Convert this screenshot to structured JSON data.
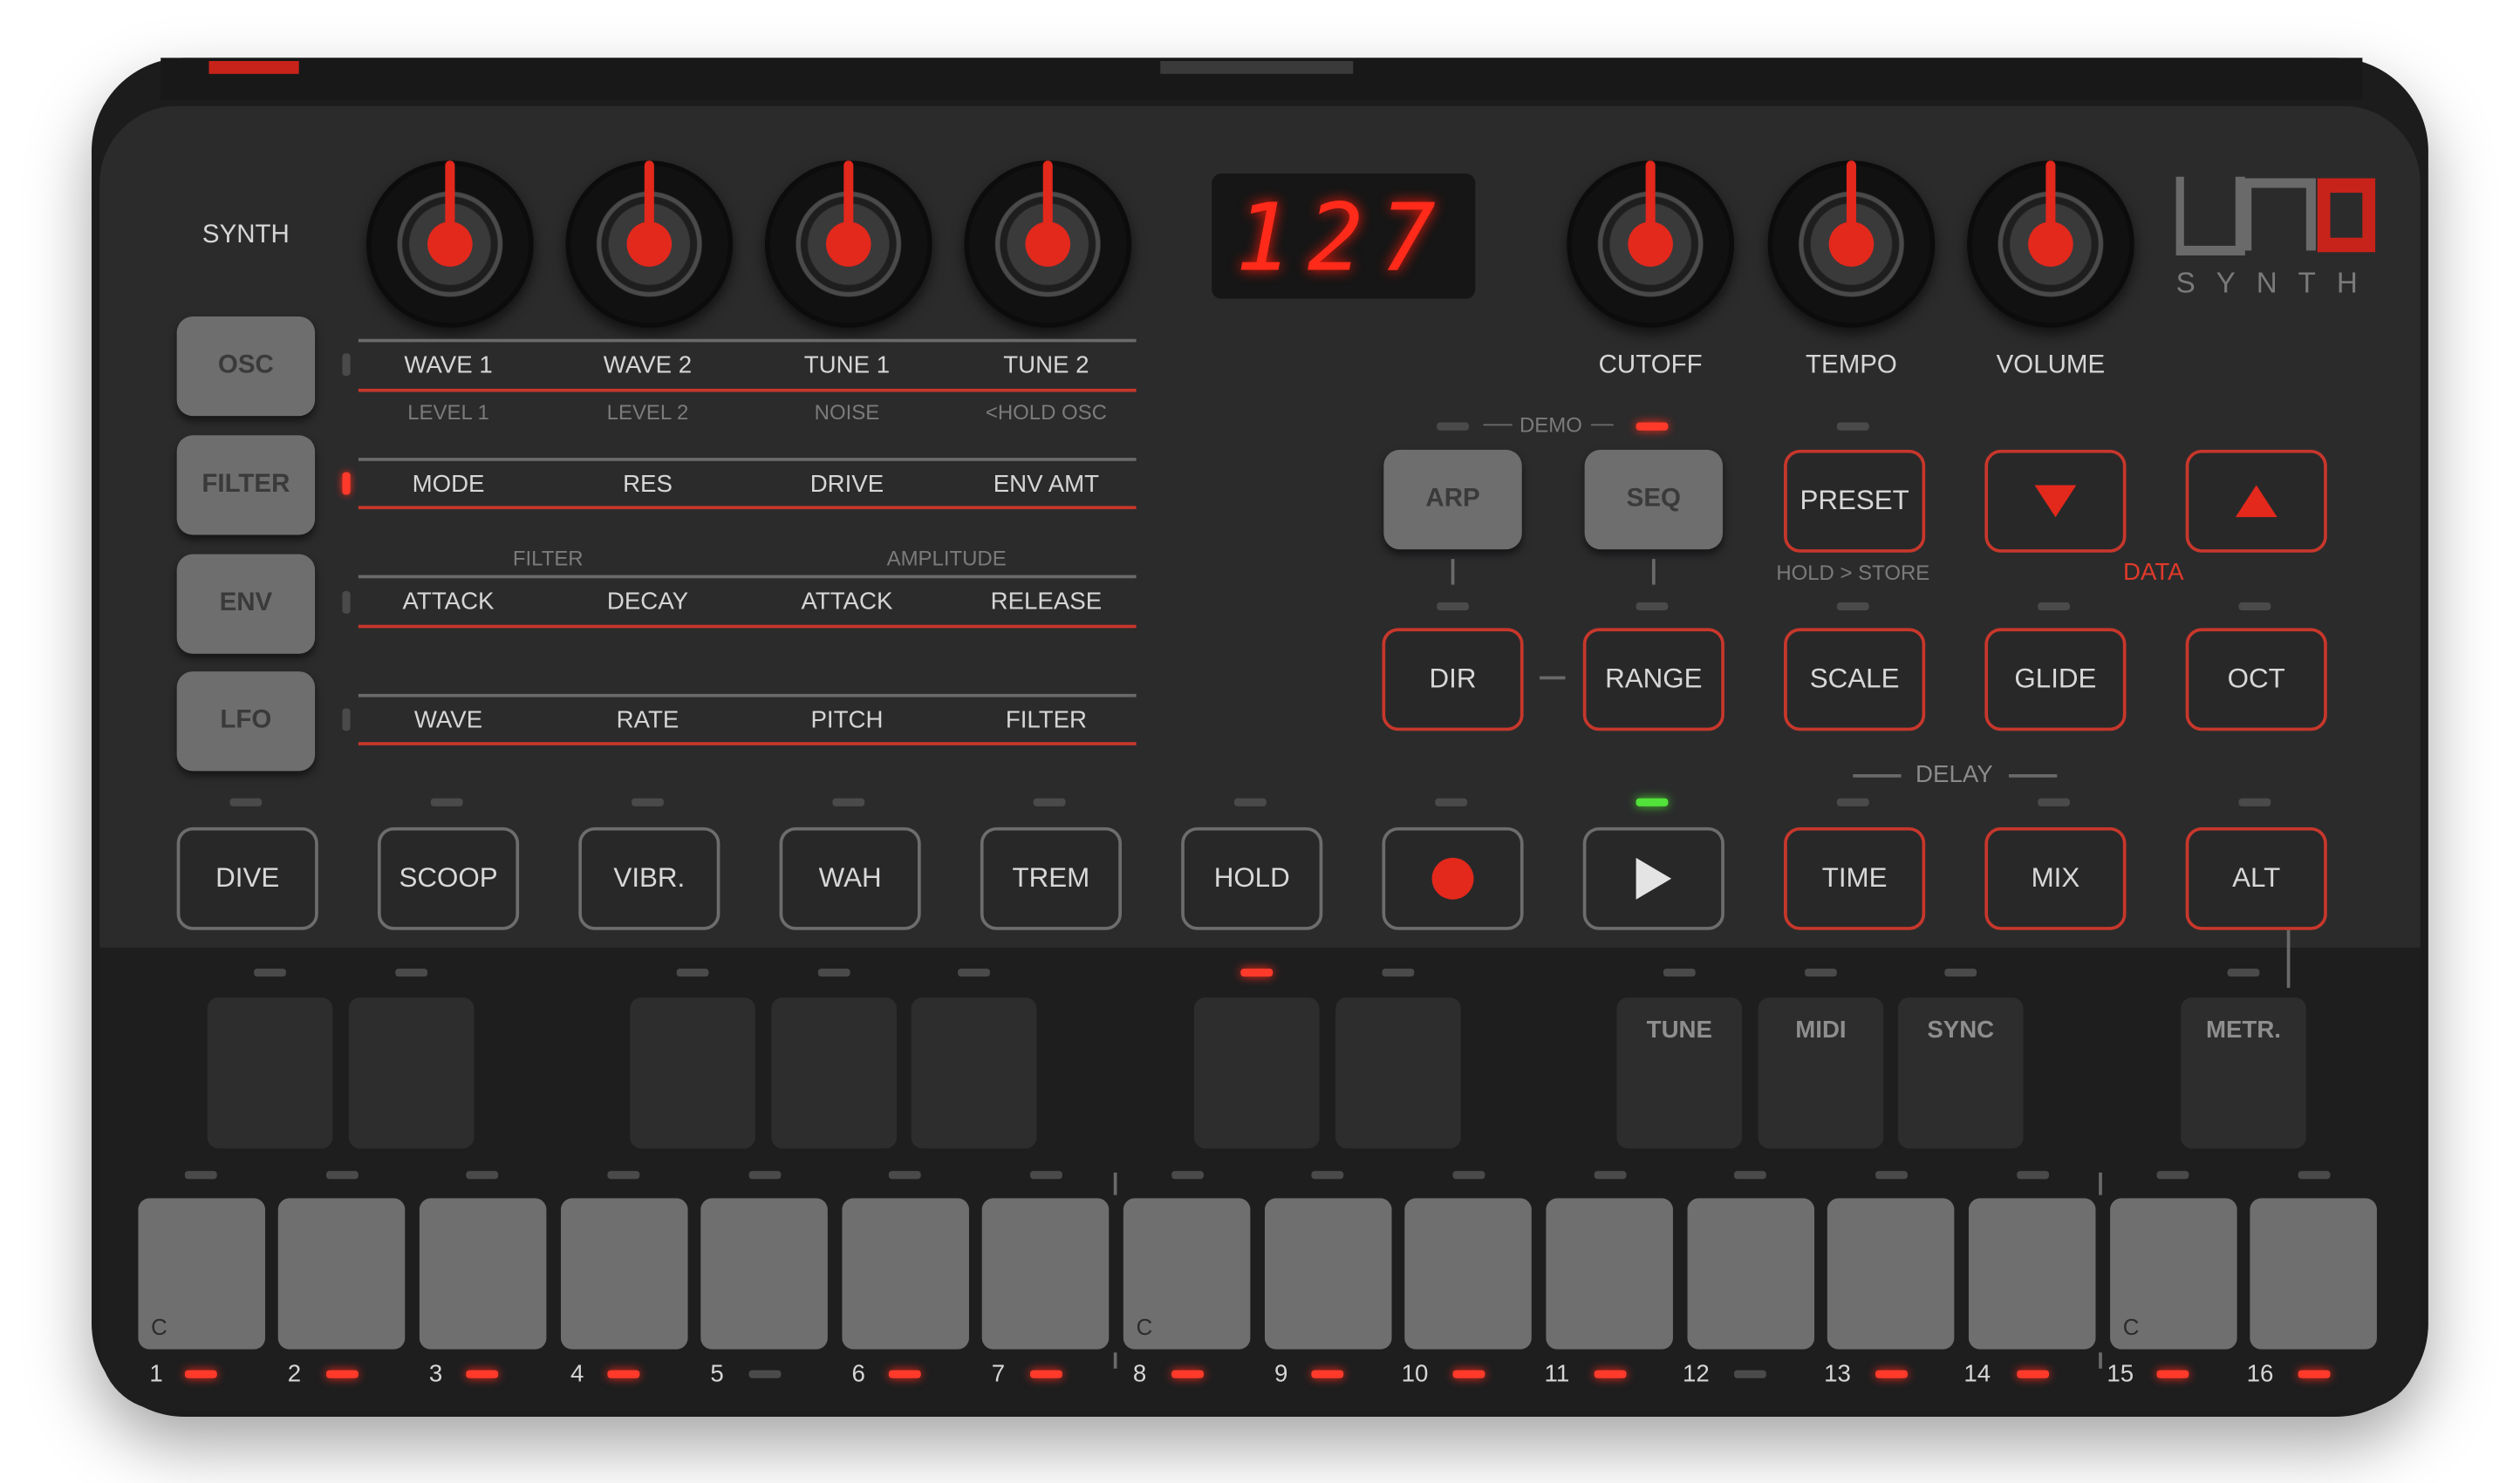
{
  "brand": {
    "logo_text": "UNO",
    "subtitle": "SYNTH"
  },
  "display": {
    "value": "127"
  },
  "section_label": "SYNTH",
  "knobs_left": [
    "knob-1",
    "knob-2",
    "knob-3",
    "knob-4"
  ],
  "knobs_right": [
    {
      "label": "CUTOFF"
    },
    {
      "label": "TEMPO"
    },
    {
      "label": "VOLUME"
    }
  ],
  "modes": [
    {
      "label": "OSC",
      "active": false,
      "params": [
        "WAVE 1",
        "WAVE 2",
        "TUNE 1",
        "TUNE 2"
      ],
      "alt": [
        "LEVEL 1",
        "LEVEL 2",
        "NOISE",
        "<HOLD OSC"
      ]
    },
    {
      "label": "FILTER",
      "active": true,
      "params": [
        "MODE",
        "RES",
        "DRIVE",
        "ENV AMT"
      ],
      "alt": []
    },
    {
      "label": "ENV",
      "active": false,
      "params": [
        "ATTACK",
        "DECAY",
        "ATTACK",
        "RELEASE"
      ],
      "groups": [
        "FILTER",
        "AMPLITUDE"
      ]
    },
    {
      "label": "LFO",
      "active": false,
      "params": [
        "WAVE",
        "RATE",
        "PITCH",
        "FILTER"
      ]
    }
  ],
  "demo_label": "DEMO",
  "arp_seq": {
    "arp": "ARP",
    "seq": "SEQ"
  },
  "preset": {
    "label": "PRESET",
    "hint": "HOLD > STORE"
  },
  "data_label": "DATA",
  "row2": {
    "dir": "DIR",
    "range": "RANGE",
    "scale": "SCALE",
    "glide": "GLIDE",
    "oct": "OCT"
  },
  "delay_label": "DELAY",
  "fx_buttons": [
    "DIVE",
    "SCOOP",
    "VIBR.",
    "WAH",
    "TREM",
    "HOLD"
  ],
  "transport": {
    "record": "record-icon",
    "play": "play-icon"
  },
  "delay_buttons": {
    "time": "TIME",
    "mix": "MIX",
    "alt": "ALT"
  },
  "function_pads": {
    "tune": "TUNE",
    "midi": "MIDI",
    "sync": "SYNC",
    "metr": "METR."
  },
  "keys": {
    "c_label": "C",
    "numbers": [
      "1",
      "2",
      "3",
      "4",
      "5",
      "6",
      "7",
      "8",
      "9",
      "10",
      "11",
      "12",
      "13",
      "14",
      "15",
      "16"
    ]
  },
  "colors": {
    "accent": "#e3281c",
    "panel": "#2b2b2c",
    "led_green": "#52e23a"
  }
}
